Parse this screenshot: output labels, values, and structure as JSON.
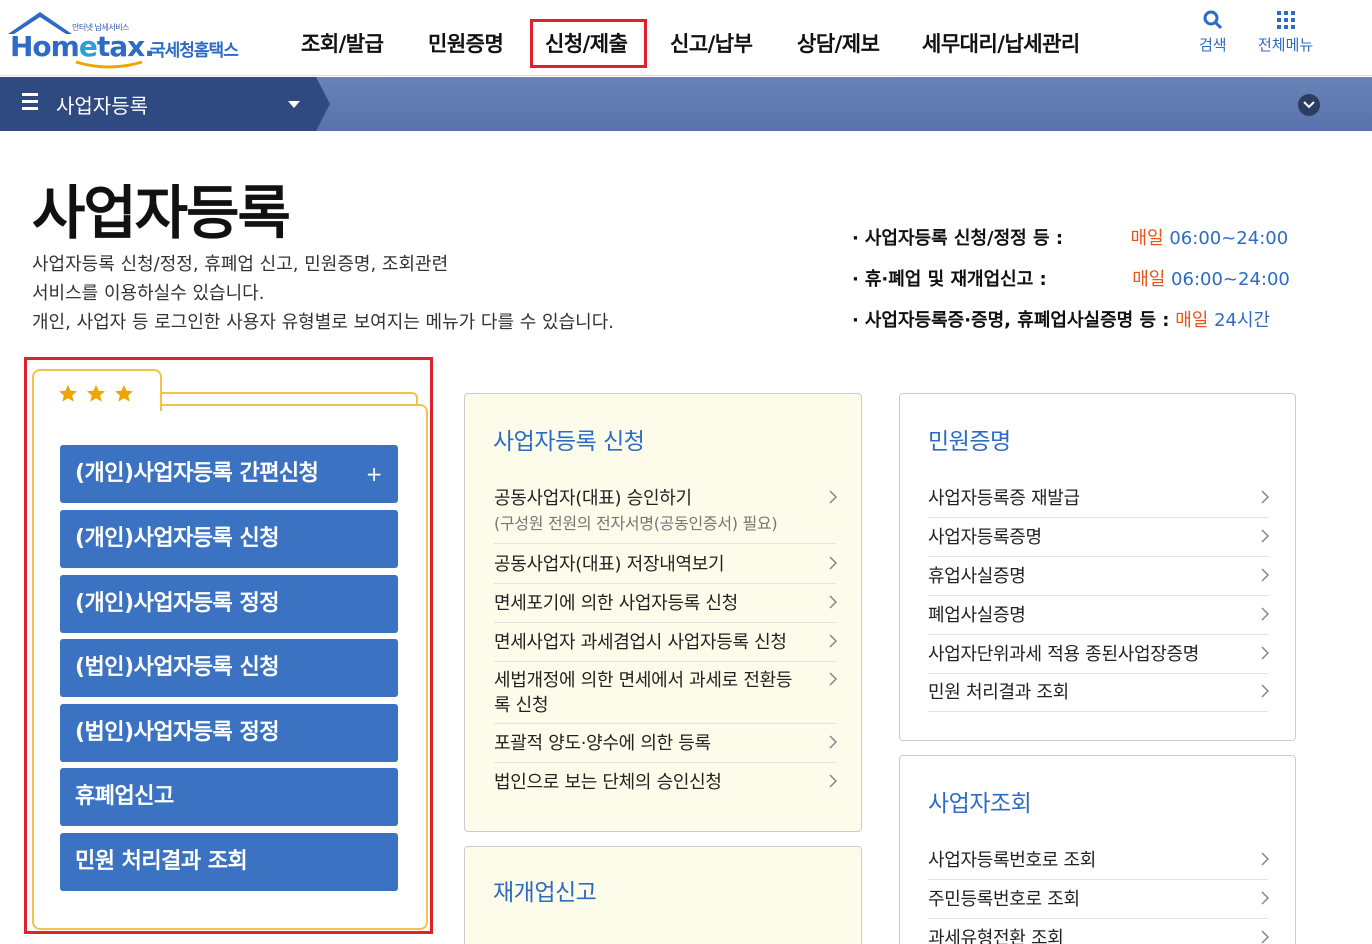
{
  "header": {
    "logo_tag": "안터넷 납세서비스",
    "logo_main_a": "Hom",
    "logo_main_e": "e",
    "logo_main_b": "tax.",
    "logo_kr": "국세청홈택스",
    "nav": [
      "조회/발급",
      "민원증명",
      "신청/제출",
      "신고/납부",
      "상담/제보",
      "세무대리/납세관리"
    ],
    "search_label": "검색",
    "allmenu_label": "전체메뉴"
  },
  "subbar": {
    "title": "사업자등록"
  },
  "page": {
    "title": "사업자등록",
    "desc": [
      "사업자등록 신청/정정, 휴폐업 신고, 민원증명, 조회관련",
      "서비스를 이용하실수 있습니다.",
      "개인, 사업자 등 로그인한 사용자 유형별로 보여지는 메뉴가 다를 수 있습니다."
    ],
    "hours": [
      {
        "label": "사업자등록 신청/정정 등 :",
        "prefix": "매일",
        "time": "06:00~24:00"
      },
      {
        "label": "휴·폐업 및 재개업신고 :",
        "prefix": "매일",
        "time": "06:00~24:00"
      },
      {
        "label": "사업자등록증·증명, 휴폐업사실증명 등 :",
        "prefix": "매일",
        "time": "24시간"
      }
    ]
  },
  "favorites": {
    "buttons": [
      "(개인)사업자등록 간편신청",
      "(개인)사업자등록 신청",
      "(개인)사업자등록 정정",
      "(법인)사업자등록 신청",
      "(법인)사업자등록 정정",
      "휴폐업신고",
      "민원 처리결과 조회"
    ],
    "plus": "+"
  },
  "cards": {
    "apply": {
      "title": "사업자등록 신청",
      "items": [
        {
          "label": "공동사업자(대표) 승인하기",
          "sub": "(구성원 전원의 전자서명(공동인증서) 필요)"
        },
        {
          "label": "공동사업자(대표) 저장내역보기"
        },
        {
          "label": "면세포기에 의한 사업자등록 신청"
        },
        {
          "label": "면세사업자 과세겸업시 사업자등록 신청"
        },
        {
          "label": "세법개정에 의한 면세에서 과세로 전환등",
          "label2": "록 신청"
        },
        {
          "label": "포괄적 양도·양수에 의한 등록"
        },
        {
          "label": "법인으로 보는 단체의 승인신청"
        }
      ]
    },
    "reopen": {
      "title": "재개업신고"
    },
    "certificate": {
      "title": "민원증명",
      "items": [
        "사업자등록증 재발급",
        "사업자등록증명",
        "휴업사실증명",
        "폐업사실증명",
        "사업자단위과세 적용 종된사업장증명",
        "민원 처리결과 조회"
      ]
    },
    "lookup": {
      "title": "사업자조회",
      "items": [
        "사업자등록번호로 조회",
        "주민등록번호로 조회",
        "과세유형전환 조회"
      ]
    }
  },
  "colors": {
    "accent_blue": "#2d6bc4",
    "button_blue": "#3b73c2",
    "highlight_red": "#e0202a",
    "time_red": "#e8541c",
    "star": "#f0a400"
  }
}
